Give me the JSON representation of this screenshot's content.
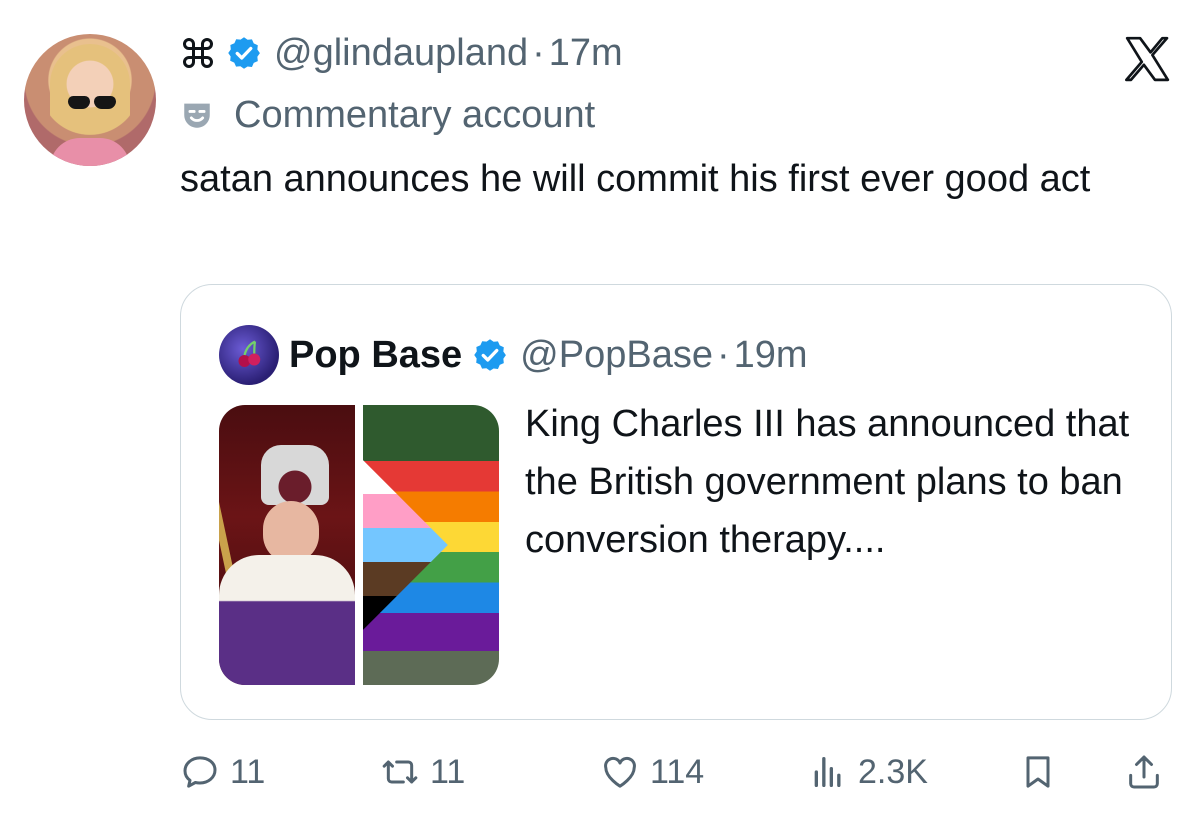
{
  "post": {
    "author": {
      "badge_icon": "command-key-icon",
      "verified_icon": "verified-badge-icon",
      "handle": "@glindaupland",
      "separator": "·",
      "time": "17m",
      "label_icon": "theater-mask-icon",
      "label": "Commentary account"
    },
    "text": "satan announces he will commit his first ever good act",
    "quoted": {
      "name": "Pop Base",
      "verified_icon": "verified-badge-icon",
      "handle": "@PopBase",
      "separator": "·",
      "time": "19m",
      "text": "King Charles III has announced that the British government plans to ban conversion therapy...."
    },
    "actions": {
      "reply_count": "11",
      "retweet_count": "11",
      "like_count": "114",
      "views_count": "2.3K"
    }
  },
  "colors": {
    "text": "#0f1419",
    "secondary": "#536471",
    "verified": "#1d9bf0",
    "border": "#cfd9de"
  }
}
